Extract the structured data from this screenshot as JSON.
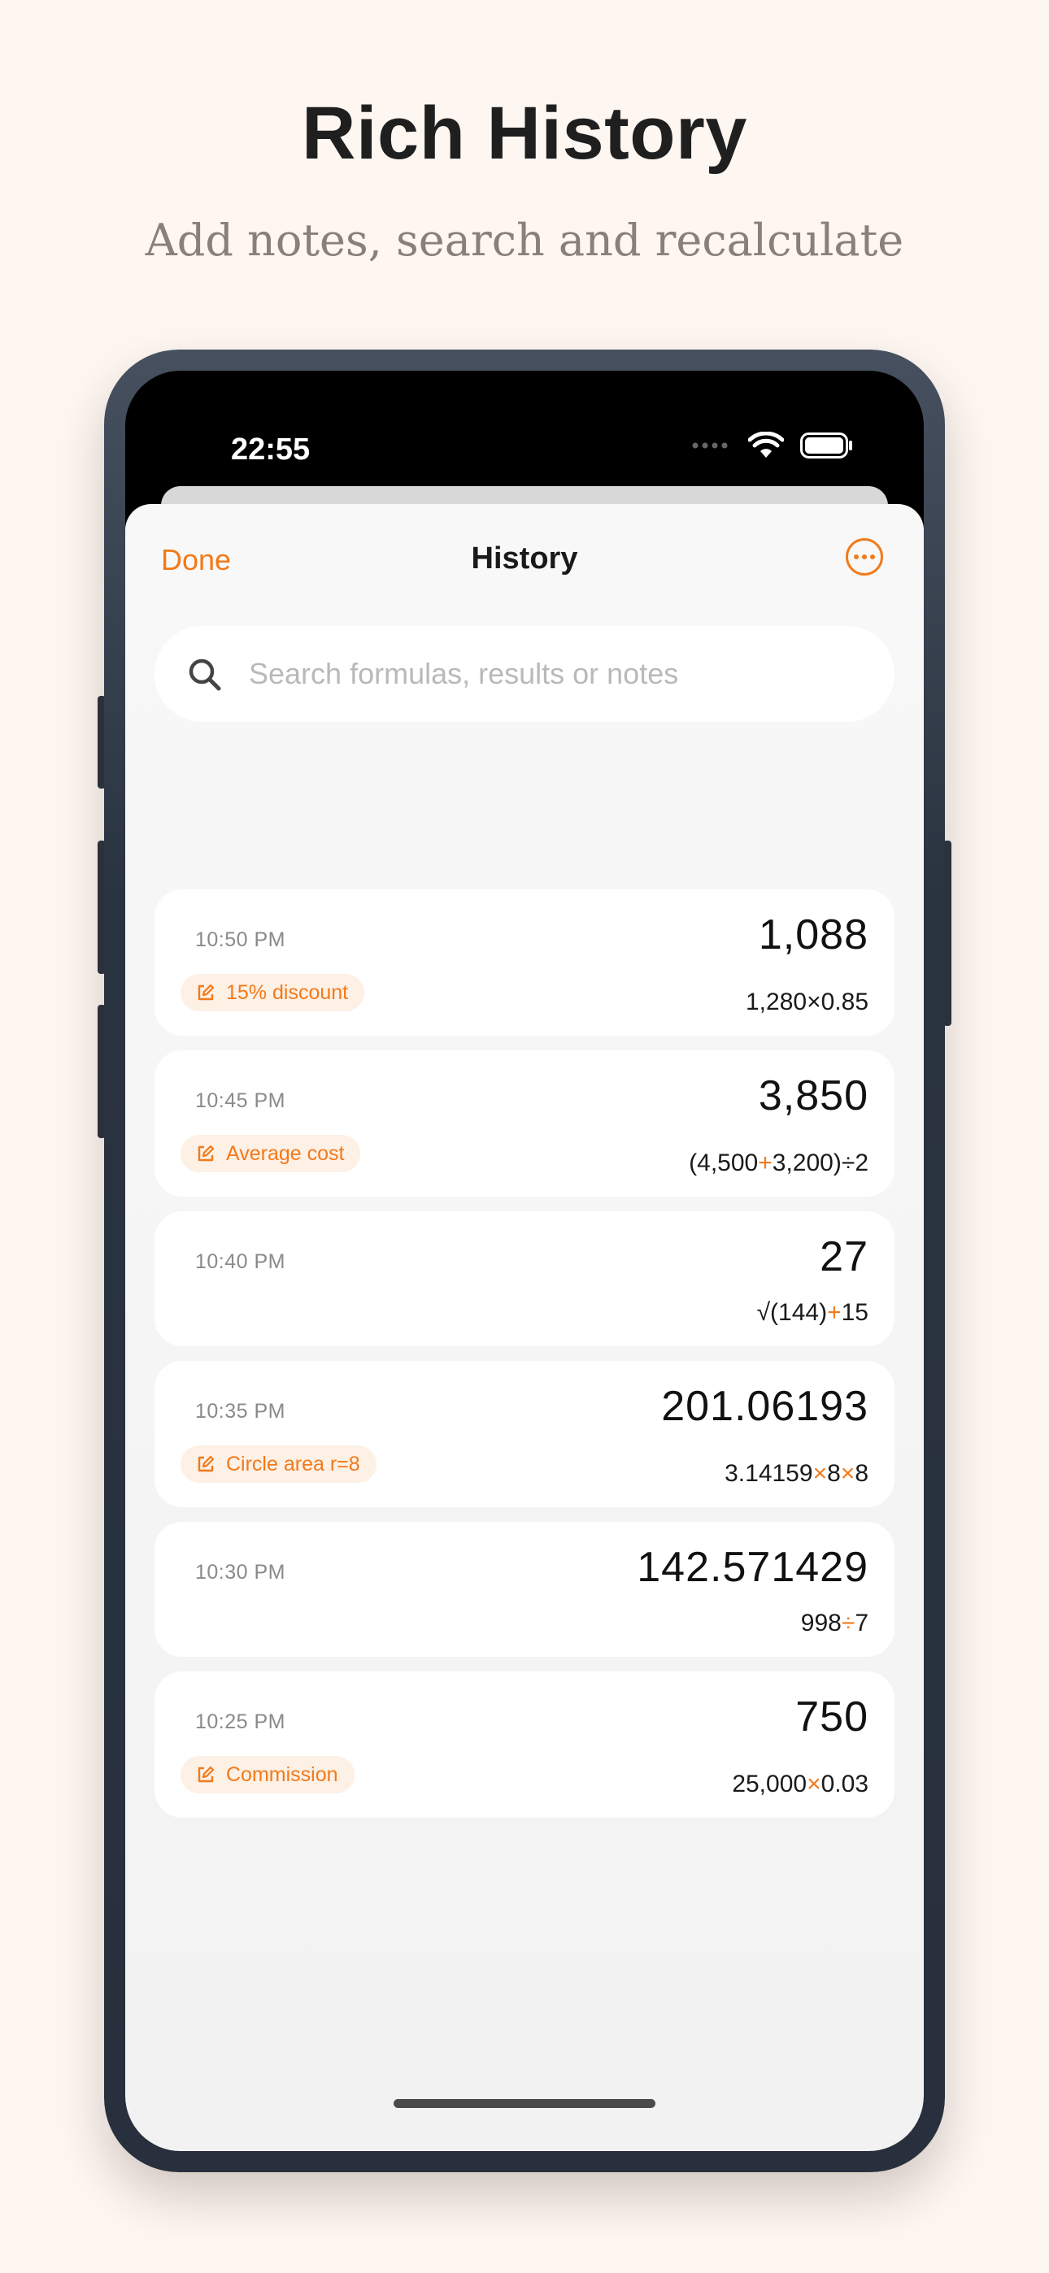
{
  "hero": {
    "title": "Rich History",
    "subtitle": "Add notes, search and recalculate"
  },
  "status_bar": {
    "time": "22:55",
    "icons": [
      "signal-dots-icon",
      "wifi-icon",
      "battery-icon"
    ]
  },
  "nav": {
    "done_label": "Done",
    "title": "History",
    "more_icon": "ellipsis-circle-icon"
  },
  "search": {
    "placeholder": "Search formulas, results or notes",
    "value": ""
  },
  "history": [
    {
      "time": "10:50 PM",
      "result": "1,088",
      "formula": [
        {
          "t": "1,280"
        },
        {
          "t": "×",
          "op": false
        },
        {
          "t": "0.85"
        }
      ],
      "note": "15% discount"
    },
    {
      "time": "10:45 PM",
      "result": "3,850",
      "formula": [
        {
          "t": "(4,500"
        },
        {
          "t": "+",
          "op": true
        },
        {
          "t": "3,200)"
        },
        {
          "t": "÷",
          "op": false
        },
        {
          "t": "2"
        }
      ],
      "note": "Average cost"
    },
    {
      "time": "10:40 PM",
      "result": "27",
      "formula": [
        {
          "t": "√(144)"
        },
        {
          "t": "+",
          "op": true
        },
        {
          "t": "15"
        }
      ],
      "note": ""
    },
    {
      "time": "10:35 PM",
      "result": "201.06193",
      "formula": [
        {
          "t": "3.14159"
        },
        {
          "t": "×",
          "op": true
        },
        {
          "t": "8"
        },
        {
          "t": "×",
          "op": true
        },
        {
          "t": "8"
        }
      ],
      "note": "Circle area r=8"
    },
    {
      "time": "10:30 PM",
      "result": "142.571429",
      "formula": [
        {
          "t": "998"
        },
        {
          "t": "÷",
          "op": true
        },
        {
          "t": "7"
        }
      ],
      "note": ""
    },
    {
      "time": "10:25 PM",
      "result": "750",
      "formula": [
        {
          "t": "25,000"
        },
        {
          "t": "×",
          "op": true
        },
        {
          "t": "0.03"
        }
      ],
      "note": "Commission"
    }
  ],
  "colors": {
    "accent": "#f27a1a",
    "background": "#fdf6f1",
    "phone_frame": "#2a3340"
  }
}
